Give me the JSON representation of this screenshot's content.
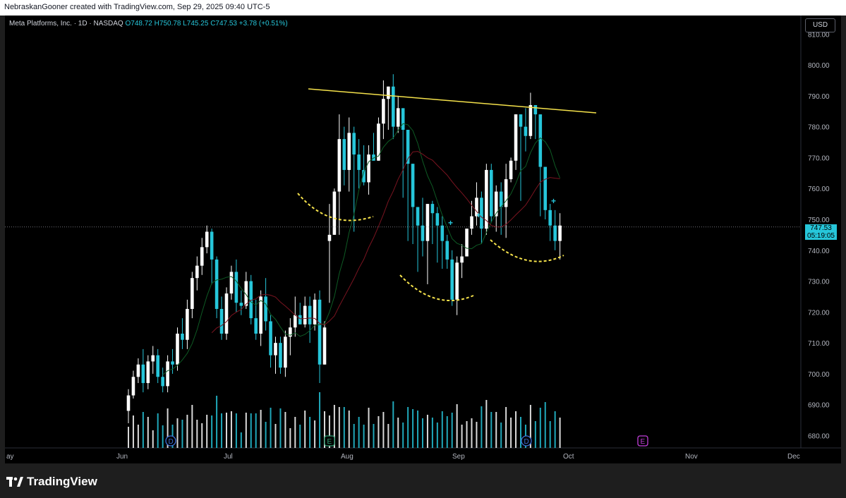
{
  "header": {
    "caption": "NebraskanGooner created with TradingView.com, Sep 29, 2025 09:40 UTC-5"
  },
  "legend": {
    "symbol": "Meta Platforms, Inc. · 1D · NASDAQ",
    "open": "O748.72",
    "high": "H750.78",
    "low": "L745.25",
    "close": "C747.53",
    "change": "+3.78 (+0.51%)"
  },
  "currency_button": "USD",
  "last_price": {
    "price": "747.53",
    "countdown": "05:19:05"
  },
  "brand": "TradingView",
  "colors": {
    "up": "#ffffff",
    "down": "#26c6da",
    "ma_fast": "#0e5a24",
    "ma_slow": "#7a1420",
    "resistance": "#f5e24b",
    "pattern": "#f5e24b"
  },
  "chart_data": {
    "type": "candlestick",
    "symbol": "META",
    "interval": "1D",
    "ylim": [
      676,
      816
    ],
    "y_ticks": [
      680,
      690,
      700,
      710,
      720,
      730,
      740,
      750,
      760,
      770,
      780,
      790,
      800,
      810
    ],
    "x_tick_labels": [
      "ay",
      "Jun",
      "Jul",
      "Aug",
      "Sep",
      "Oct",
      "Nov",
      "Dec"
    ],
    "candles": [
      [
        688,
        695,
        684,
        693
      ],
      [
        693,
        701,
        692,
        699
      ],
      [
        699,
        705,
        697,
        703
      ],
      [
        703,
        708,
        694,
        697
      ],
      [
        697,
        706,
        695,
        704
      ],
      [
        704,
        709,
        700,
        706
      ],
      [
        706,
        708,
        697,
        699
      ],
      [
        699,
        702,
        694,
        696
      ],
      [
        696,
        706,
        694,
        704
      ],
      [
        704,
        708,
        700,
        703
      ],
      [
        703,
        715,
        701,
        713
      ],
      [
        713,
        718,
        708,
        711
      ],
      [
        711,
        724,
        708,
        721
      ],
      [
        721,
        733,
        718,
        731
      ],
      [
        731,
        738,
        727,
        735
      ],
      [
        735,
        744,
        732,
        741
      ],
      [
        741,
        748,
        739,
        746
      ],
      [
        746,
        747,
        729,
        737
      ],
      [
        737,
        738,
        718,
        721
      ],
      [
        721,
        725,
        711,
        713
      ],
      [
        713,
        728,
        711,
        726
      ],
      [
        726,
        735,
        724,
        733
      ],
      [
        733,
        737,
        720,
        723
      ],
      [
        723,
        727,
        719,
        722
      ],
      [
        722,
        733,
        721,
        730
      ],
      [
        730,
        732,
        716,
        718
      ],
      [
        718,
        724,
        711,
        713
      ],
      [
        713,
        727,
        709,
        725
      ],
      [
        725,
        731,
        714,
        717
      ],
      [
        717,
        719,
        702,
        706
      ],
      [
        706,
        712,
        700,
        710
      ],
      [
        710,
        712,
        700,
        702
      ],
      [
        702,
        714,
        699,
        712
      ],
      [
        712,
        718,
        706,
        715
      ],
      [
        715,
        725,
        712,
        719
      ],
      [
        719,
        723,
        716,
        716
      ],
      [
        716,
        725,
        715,
        722
      ],
      [
        722,
        725,
        710,
        716
      ],
      [
        716,
        726,
        714,
        724
      ],
      [
        724,
        727,
        697,
        703
      ],
      [
        703,
        717,
        704,
        715
      ],
      [
        743,
        755,
        723,
        745
      ],
      [
        745,
        760,
        745,
        759
      ],
      [
        759,
        784,
        745,
        776
      ],
      [
        776,
        780,
        761,
        766
      ],
      [
        766,
        783,
        759,
        778
      ],
      [
        778,
        780,
        746,
        771
      ],
      [
        771,
        776,
        760,
        766
      ],
      [
        766,
        774,
        761,
        762
      ],
      [
        762,
        774,
        758,
        771
      ],
      [
        771,
        778,
        769,
        769
      ],
      [
        769,
        783,
        778,
        781
      ],
      [
        781,
        795,
        776,
        789
      ],
      [
        789,
        788,
        779,
        793
      ],
      [
        793,
        797,
        776,
        780
      ],
      [
        780,
        790,
        778,
        786
      ],
      [
        786,
        782,
        757,
        779
      ],
      [
        779,
        758,
        743,
        768
      ],
      [
        768,
        752,
        742,
        754
      ],
      [
        754,
        752,
        733,
        748
      ],
      [
        748,
        757,
        738,
        743
      ],
      [
        743,
        747,
        729,
        755
      ],
      [
        755,
        756,
        742,
        752
      ],
      [
        752,
        754,
        736,
        748
      ],
      [
        748,
        751,
        734,
        743
      ],
      [
        743,
        745,
        734,
        737
      ],
      [
        737,
        740,
        722,
        724
      ],
      [
        724,
        738,
        719,
        736
      ],
      [
        736,
        742,
        731,
        738
      ],
      [
        738,
        745,
        742,
        747
      ],
      [
        747,
        756,
        745,
        751
      ],
      [
        751,
        762,
        748,
        757
      ],
      [
        757,
        759,
        742,
        747
      ],
      [
        747,
        768,
        745,
        766
      ],
      [
        766,
        768,
        749,
        751
      ],
      [
        751,
        761,
        746,
        759
      ],
      [
        759,
        762,
        745,
        754
      ],
      [
        754,
        768,
        744,
        763
      ],
      [
        763,
        770,
        762,
        769
      ],
      [
        769,
        782,
        766,
        784
      ],
      [
        784,
        783,
        756,
        780
      ],
      [
        780,
        786,
        772,
        777
      ],
      [
        777,
        791,
        776,
        787
      ],
      [
        787,
        787,
        776,
        784
      ],
      [
        784,
        773,
        751,
        767
      ],
      [
        767,
        758,
        750,
        753
      ],
      [
        753,
        755,
        743,
        748
      ],
      [
        748,
        753,
        740,
        743
      ],
      [
        743,
        752,
        737,
        748
      ]
    ],
    "volume_note": "volume bars shown as relative heights at bottom",
    "annotations": {
      "resistance_line": {
        "from": [
          "Aug",
          793
        ],
        "to": [
          "Sep end",
          788
        ]
      },
      "pattern": "inverse head and shoulders (dashed arcs)",
      "markers": [
        "D",
        "E",
        "D",
        "E"
      ]
    }
  }
}
